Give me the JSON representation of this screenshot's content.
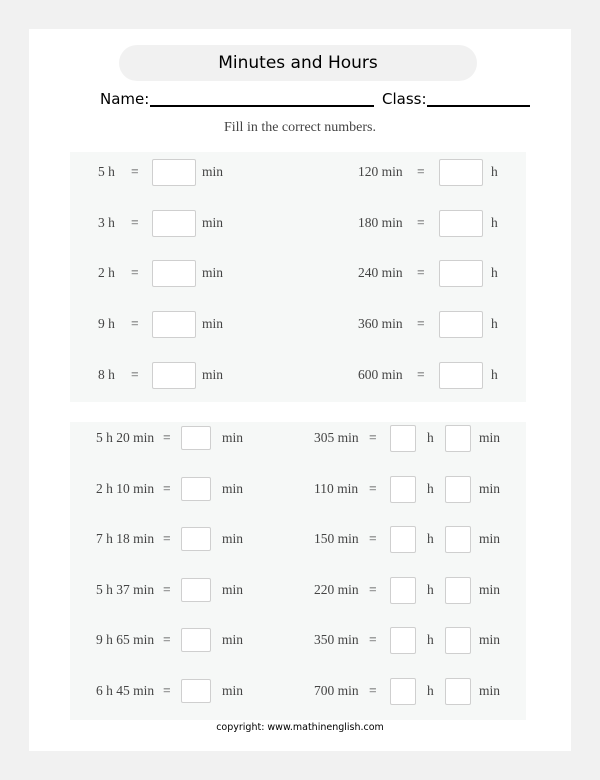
{
  "worksheet": {
    "title": "Minutes and Hours",
    "name_label": "Name:",
    "class_label": "Class:",
    "instruction": "Fill in the correct numbers.",
    "equals": "=",
    "section1": {
      "left": [
        {
          "given": "5 h",
          "answer_unit": "min"
        },
        {
          "given": "3 h",
          "answer_unit": "min"
        },
        {
          "given": "2 h",
          "answer_unit": "min"
        },
        {
          "given": "9 h",
          "answer_unit": "min"
        },
        {
          "given": "8 h",
          "answer_unit": "min"
        }
      ],
      "right": [
        {
          "given": "120 min",
          "answer_unit": "h"
        },
        {
          "given": "180 min",
          "answer_unit": "h"
        },
        {
          "given": "240 min",
          "answer_unit": "h"
        },
        {
          "given": "360 min",
          "answer_unit": "h"
        },
        {
          "given": "600 min",
          "answer_unit": "h"
        }
      ]
    },
    "section2": {
      "left": [
        {
          "given": "5 h 20 min",
          "answer_unit": "min"
        },
        {
          "given": "2 h 10 min",
          "answer_unit": "min"
        },
        {
          "given": "7 h 18 min",
          "answer_unit": "min"
        },
        {
          "given": "5 h 37 min",
          "answer_unit": "min"
        },
        {
          "given": "9 h 65 min",
          "answer_unit": "min"
        },
        {
          "given": "6 h 45 min",
          "answer_unit": "min"
        }
      ],
      "right": [
        {
          "given": "305 min",
          "unit_h": "h",
          "unit_min": "min"
        },
        {
          "given": "110 min",
          "unit_h": "h",
          "unit_min": "min"
        },
        {
          "given": "150 min",
          "unit_h": "h",
          "unit_min": "min"
        },
        {
          "given": "220 min",
          "unit_h": "h",
          "unit_min": "min"
        },
        {
          "given": "350 min",
          "unit_h": "h",
          "unit_min": "min"
        },
        {
          "given": "700 min",
          "unit_h": "h",
          "unit_min": "min"
        }
      ]
    },
    "copyright": "copyright:    www.mathinenglish.com"
  }
}
